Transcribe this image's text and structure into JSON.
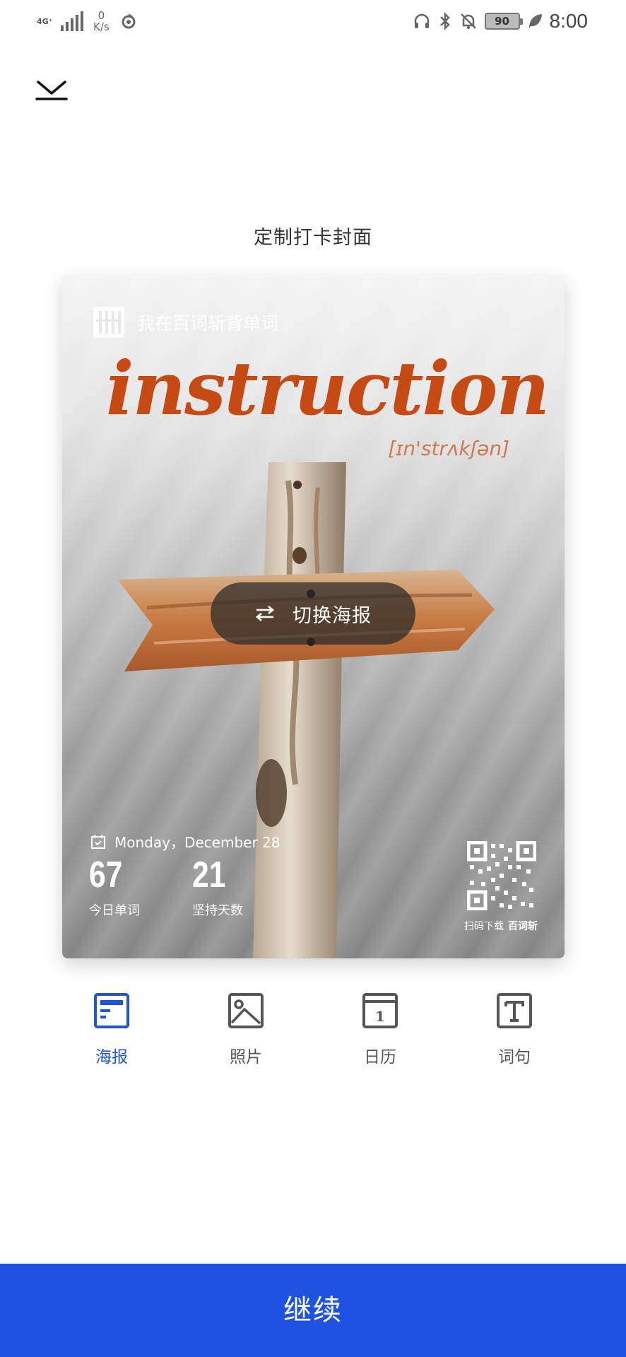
{
  "status_bar": {
    "network_type": "4G⁺",
    "speed_value": "0",
    "speed_unit": "K/s",
    "battery": "90",
    "time": "8:00"
  },
  "header": {
    "title": "定制打卡封面"
  },
  "poster": {
    "brand_text": "我在百词斩背单词",
    "word": "instruction",
    "phonetic": "[ɪn'strʌkʃən]",
    "switch_label": "切换海报",
    "date": "Monday，December 28",
    "today_words": "67",
    "today_words_label": "今日单词",
    "streak_days": "21",
    "streak_days_label": "坚持天数",
    "qr_caption_prefix": "扫码下载",
    "qr_caption_brand": "百词斩"
  },
  "tabs": [
    {
      "label": "海报",
      "icon": "poster-icon",
      "active": true
    },
    {
      "label": "照片",
      "icon": "photo-icon",
      "active": false
    },
    {
      "label": "日历",
      "icon": "calendar-icon",
      "active": false
    },
    {
      "label": "词句",
      "icon": "text-icon",
      "active": false
    }
  ],
  "footer": {
    "continue_label": "继续"
  },
  "colors": {
    "accent": "#1f52e0",
    "word": "#c64a14"
  }
}
